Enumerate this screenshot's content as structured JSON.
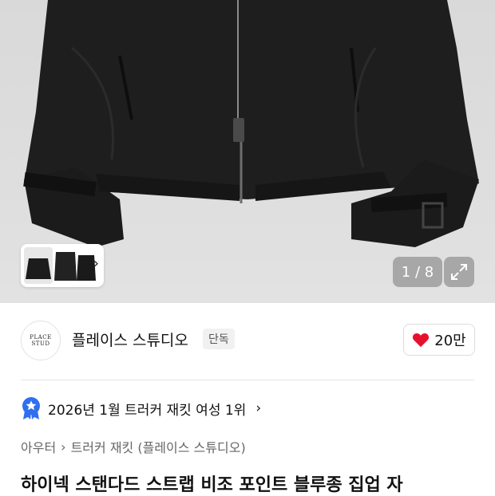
{
  "gallery": {
    "counter": "1 / 8",
    "thumbnail_icon": "chevron-right-icon",
    "expand_icon": "expand-icon"
  },
  "brand": {
    "logo_line1": "PLACE",
    "logo_line2": "STUD",
    "name": "플레이스 스튜디오",
    "exclusive_label": "단독",
    "like_icon": "heart-icon",
    "like_count": "20만",
    "like_color": "#e8112d"
  },
  "ranking": {
    "icon": "ranking-badge-icon",
    "text": "2026년 1월 트러커 재킷 여성 1위",
    "chevron": "›",
    "badge_color": "#2f6ff0"
  },
  "breadcrumb": {
    "category": "아우터",
    "separator": "›",
    "subcategory": "트러커 재킷 (플레이스 스튜디오)"
  },
  "product": {
    "title": "하이넥 스탠다드 스트랩 비조 포인트 블루종 집업 자"
  }
}
